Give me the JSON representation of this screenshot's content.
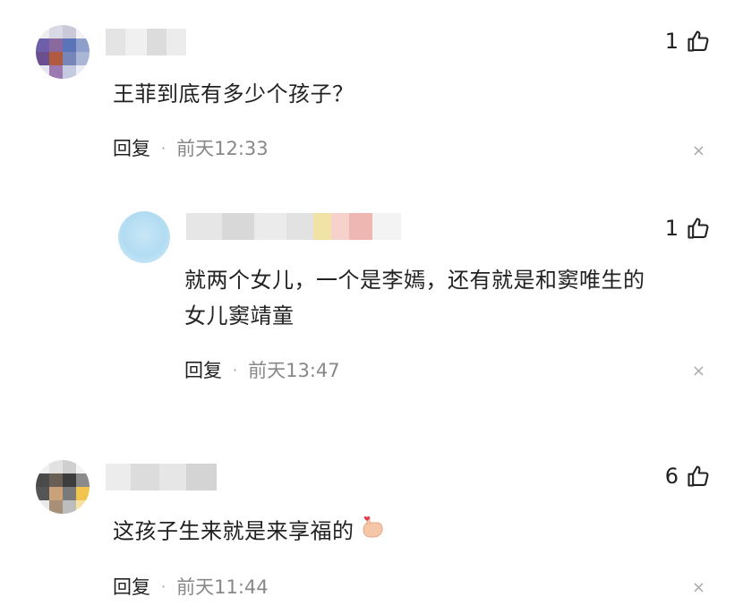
{
  "comments": [
    {
      "text": "王菲到底有多少个孩子？",
      "likes": "1",
      "reply_label": "回复",
      "dot": "·",
      "time": "前天12:33",
      "close": "×",
      "replies": [
        {
          "text_line1": "就两个女儿，一个是李嫣，还有就是和窦唯生的",
          "text_line2": "女儿窦靖童",
          "likes": "1",
          "reply_label": "回复",
          "dot": "·",
          "time": "前天13:47",
          "close": "×"
        }
      ]
    },
    {
      "text": "这孩子生来就是来享福的",
      "emoji": "pinky-promise-hand-emoji",
      "likes": "6",
      "reply_label": "回复",
      "dot": "·",
      "time": "前天11:44",
      "close": "×"
    }
  ],
  "icons": {
    "like": "thumbs-up-icon",
    "close": "close-icon"
  }
}
